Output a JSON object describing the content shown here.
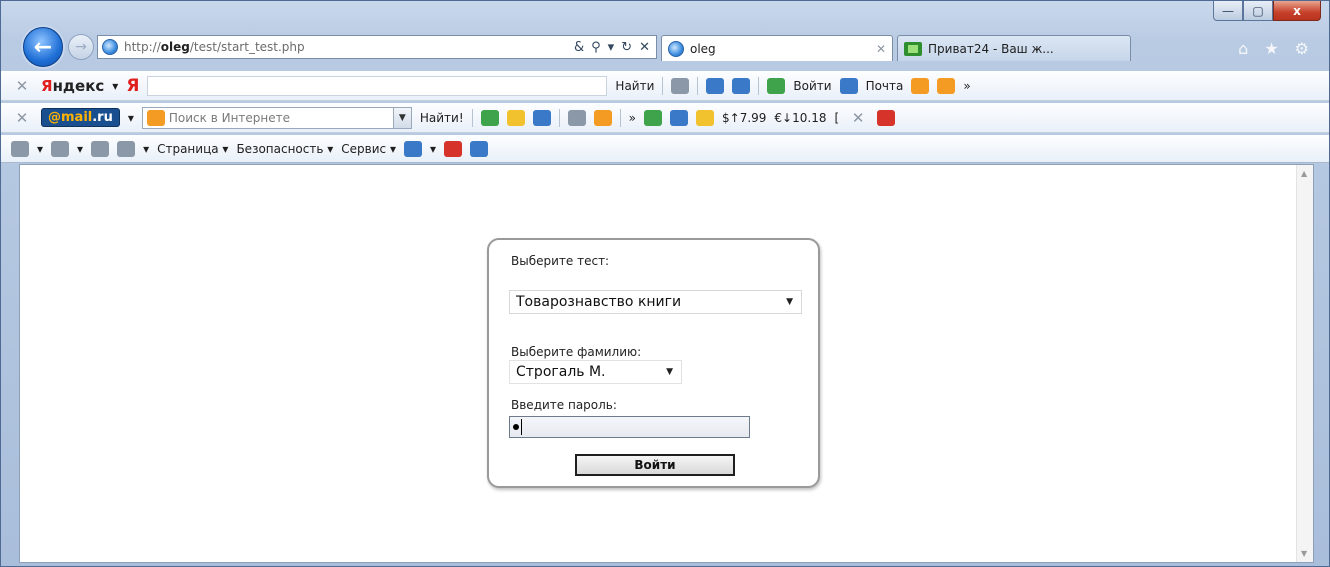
{
  "window": {
    "minimize": "—",
    "maximize": "▢",
    "close": "x"
  },
  "nav": {
    "url_prefix": "http://",
    "url_host": "oleg",
    "url_path": "/test/start_test.php",
    "address_tools": [
      "&",
      "⚲",
      "▾",
      "↻",
      "✕"
    ],
    "tabs": [
      {
        "label": "oleg",
        "close": "✕"
      },
      {
        "label": "Приват24 - Ваш ж..."
      }
    ],
    "right_icons": [
      "⌂",
      "★",
      "⚙"
    ]
  },
  "yandex_bar": {
    "close": "✕",
    "logo_prefix": "Я",
    "logo_rest": "ндекс",
    "logo_dropdown": "▾",
    "ya_icon": "Я",
    "find_button": "Найти",
    "login": "Войти",
    "mail": "Почта",
    "more": "»"
  },
  "mailru_bar": {
    "close": "✕",
    "logo_at": "@mail",
    "logo_ru": ".ru",
    "search_placeholder": "Поиск в Интернете",
    "find_button": "Найти!",
    "more": "»",
    "usd_rate": "$↑7.99",
    "eur_rate": "€↓10.18",
    "bracket": "["
  },
  "command_bar": {
    "page": "Страница",
    "safety": "Безопасность",
    "tools": "Сервис"
  },
  "form": {
    "test_label": "Выберите тест:",
    "test_value": "Товарознавство книги",
    "surname_label": "Выберите фамилию:",
    "surname_value": "Строгаль М.",
    "password_label": "Введите пароль:",
    "submit_label": "Войти"
  },
  "colors": {
    "accent_back_button": "#1f6fd6",
    "close_button": "#c6402a",
    "yandex_red": "#e01f1f",
    "mailru_blue": "#1a4f8f"
  },
  "icons": [
    "back-arrow-icon",
    "forward-arrow-icon",
    "ie-globe-icon",
    "home-icon",
    "favorites-star-icon",
    "gear-icon",
    "dropdown-arrow-icon"
  ]
}
